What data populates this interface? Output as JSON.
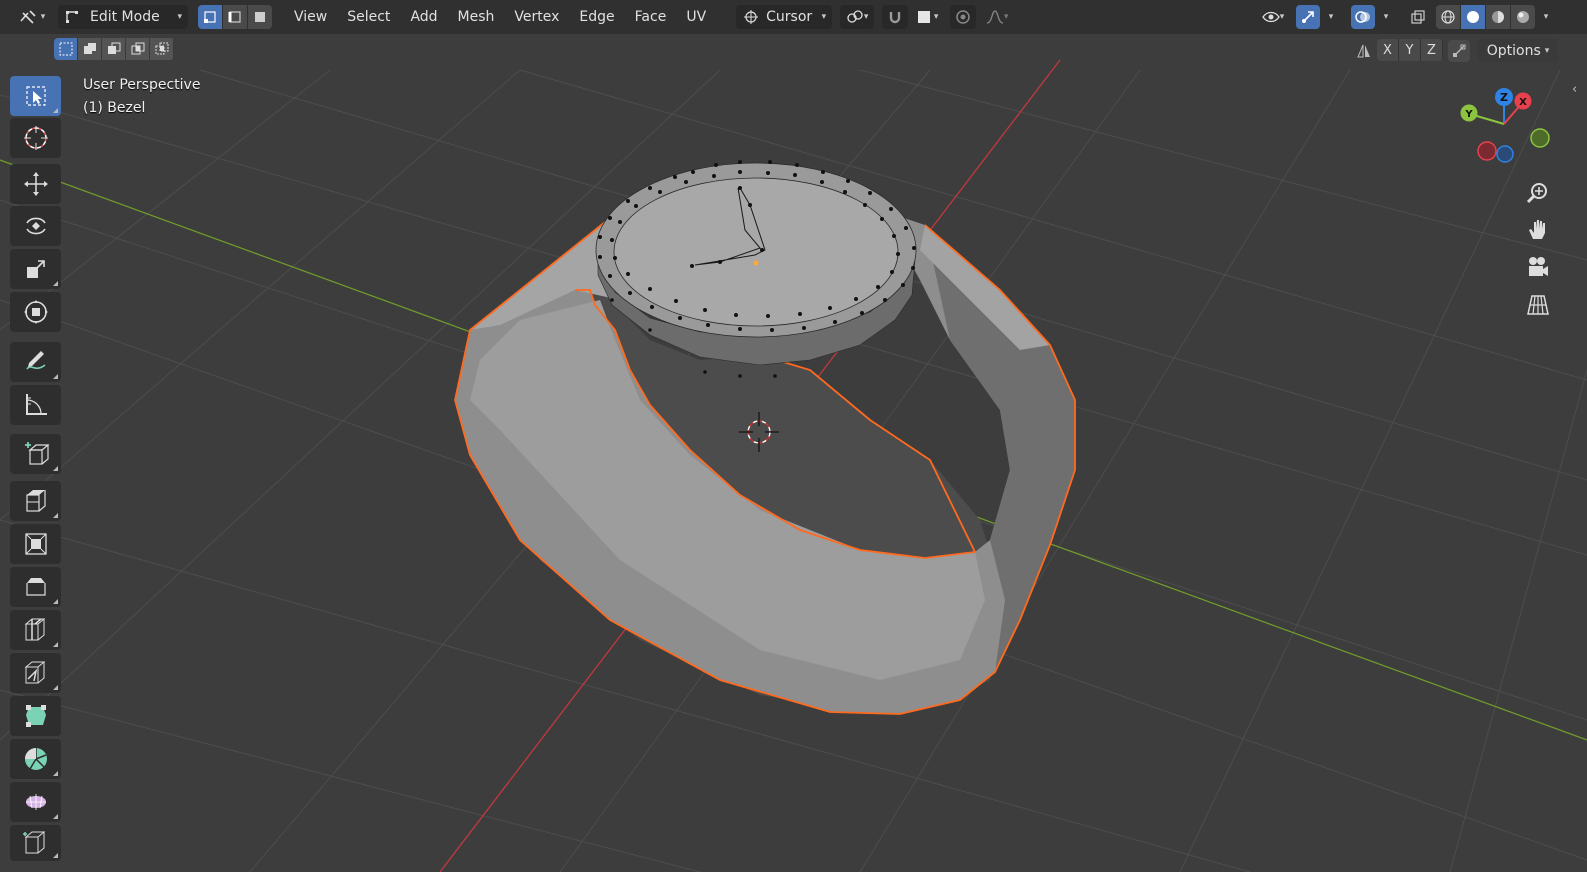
{
  "header": {
    "editor_type_icon": "editor-type-icon",
    "mode_label": "Edit Mode",
    "menus": [
      "View",
      "Select",
      "Add",
      "Mesh",
      "Vertex",
      "Edge",
      "Face",
      "UV"
    ],
    "pivot_label": "Cursor",
    "active_select_mode": "vertex"
  },
  "subrow": {
    "axis_labels": [
      "X",
      "Y",
      "Z"
    ],
    "options_label": "Options"
  },
  "overlay": {
    "view_name": "User Perspective",
    "object_name": "(1) Bezel"
  },
  "gizmo": {
    "x_label": "X",
    "y_label": "Y",
    "z_label": "Z",
    "colors": {
      "x": "#e8414e",
      "y": "#8bc53f",
      "z": "#2f83e4"
    }
  },
  "toolbar": {
    "tools": [
      "select-box-icon",
      "cursor-icon",
      "move-icon",
      "rotate-icon",
      "scale-icon",
      "transform-icon",
      "annotate-icon",
      "measure-icon",
      "add-cube-icon",
      "extrude-icon",
      "inset-icon",
      "bevel-icon",
      "loop-cut-icon",
      "knife-icon",
      "poly-build-icon",
      "spin-icon",
      "smooth-icon",
      "shear-icon"
    ]
  },
  "colors": {
    "accent": "#4772b3",
    "selection_outline": "#ff6a1f",
    "x_axis_line": "#c0393f",
    "y_axis_line": "#6e9a2a",
    "grid": "#4d4d4d",
    "background": "#3d3d3d"
  }
}
